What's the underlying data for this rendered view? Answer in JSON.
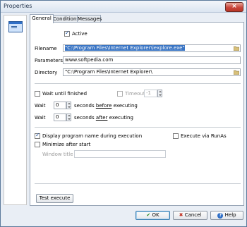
{
  "window": {
    "title": "Properties"
  },
  "tabs": [
    {
      "label": "General"
    },
    {
      "label": "Conditions"
    },
    {
      "label": "Messages"
    }
  ],
  "active_checkbox": {
    "label": "Active",
    "checked": true
  },
  "filename": {
    "label": "Filename",
    "value": "\"C:\\Program Files\\Internet Explorer\\iexplore.exe\""
  },
  "parameters": {
    "label": "Parameters",
    "value": "www.softpedia.com"
  },
  "directory": {
    "label": "Directory",
    "value": "\"C:\\Program Files\\Internet Explorer\\"
  },
  "wait_until_finished": {
    "label": "Wait until finished",
    "checked": false
  },
  "timeout": {
    "label": "Timeout",
    "value": "-1",
    "checked": false
  },
  "wait_before": {
    "label": "Wait",
    "value": "0",
    "suffix_pre": "seconds ",
    "suffix_u": "before",
    "suffix_post": " executing"
  },
  "wait_after": {
    "label": "Wait",
    "value": "0",
    "suffix_pre": "seconds ",
    "suffix_u": "after",
    "suffix_post": " executing"
  },
  "display_name": {
    "label": "Display program name during execution",
    "checked": true
  },
  "execute_runas": {
    "label": "Execute via RunAs",
    "checked": false
  },
  "minimize": {
    "label": "Minimize after start",
    "checked": false
  },
  "window_title": {
    "label": "Window title",
    "value": ""
  },
  "buttons": {
    "test_execute": "Test execute",
    "ok": "OK",
    "cancel": "Cancel",
    "help": "Help"
  },
  "icons": {
    "close": "close-icon",
    "browse": "folder-browse-icon",
    "help": "help-icon",
    "cancel": "cancel-icon",
    "ok": "check-icon"
  }
}
